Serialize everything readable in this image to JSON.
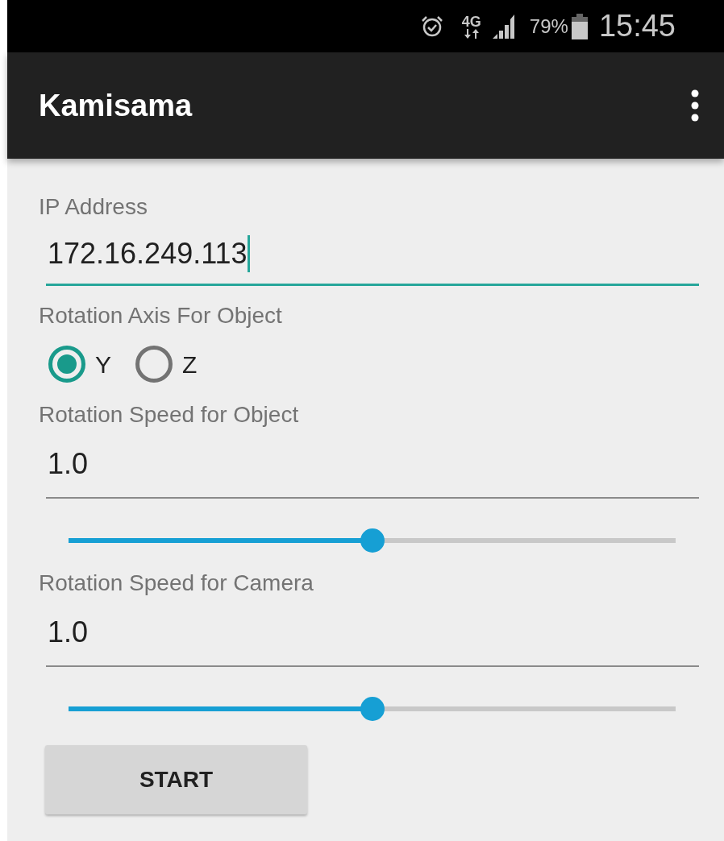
{
  "status_bar": {
    "network": "4G",
    "battery": "79%",
    "time": "15:45"
  },
  "app_bar": {
    "title": "Kamisama"
  },
  "form": [
    {
      "kind": "text_field",
      "label": "IP Address",
      "value": "172.16.249.113",
      "focused": true
    },
    {
      "kind": "radio_group",
      "label": "Rotation Axis For Object",
      "options": [
        {
          "label": "Y",
          "selected": true
        },
        {
          "label": "Z",
          "selected": false
        }
      ]
    },
    {
      "kind": "text_field",
      "label": "Rotation Speed for Object",
      "value": "1.0",
      "focused": false
    },
    {
      "kind": "slider",
      "level": 0.5
    },
    {
      "kind": "text_field",
      "label": "Rotation Speed for Camera",
      "value": "1.0",
      "focused": false
    },
    {
      "kind": "slider",
      "level": 0.5
    }
  ],
  "buttons": [
    {
      "label": "START"
    }
  ]
}
